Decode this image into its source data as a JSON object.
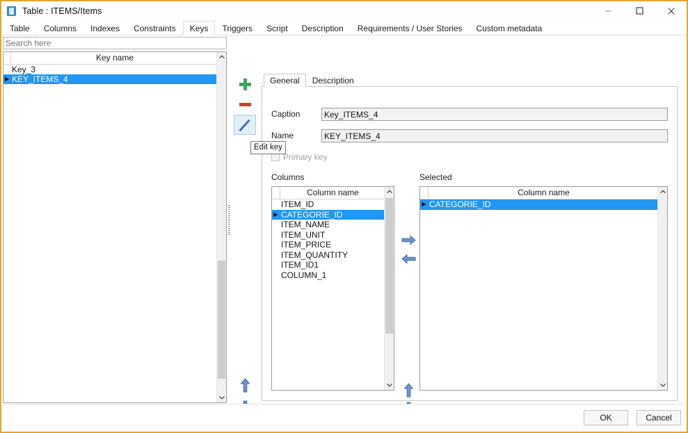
{
  "window": {
    "title": "Table : ITEMS/Items",
    "icon": "table-icon",
    "minimize_label": "–",
    "maximize_label": "□",
    "close_label": "✕",
    "border_color": "#e3a62a"
  },
  "tabs": [
    {
      "label": "Table",
      "active": false
    },
    {
      "label": "Columns",
      "active": false
    },
    {
      "label": "Indexes",
      "active": false
    },
    {
      "label": "Constraints",
      "active": false
    },
    {
      "label": "Keys",
      "active": true
    },
    {
      "label": "Triggers",
      "active": false
    },
    {
      "label": "Script",
      "active": false
    },
    {
      "label": "Description",
      "active": false
    },
    {
      "label": "Requirements / User Stories",
      "active": false
    },
    {
      "label": "Custom metadata",
      "active": false
    }
  ],
  "search": {
    "value": "",
    "placeholder": "Search here"
  },
  "keys_grid": {
    "header": "Key name",
    "rows": [
      {
        "name": "Key_3",
        "selected": false,
        "indicator": ""
      },
      {
        "name": "KEY_ITEMS_4",
        "selected": true,
        "indicator": "▶"
      }
    ]
  },
  "toolbar": {
    "add_label": "add-key",
    "remove_label": "remove-key",
    "edit_label": "edit-key",
    "tooltip": "Edit key",
    "add_color": "#3fa35f",
    "remove_color": "#c9422f",
    "edit_color": "#3f6fb4"
  },
  "inner_tabs": [
    {
      "label": "General",
      "active": true
    },
    {
      "label": "Description",
      "active": false
    }
  ],
  "general": {
    "caption_label": "Caption",
    "caption_value": "Key_ITEMS_4",
    "name_label": "Name",
    "name_value": "KEY_ITEMS_4",
    "primary_key_label": "Primary key",
    "primary_key_checked": false
  },
  "columns_panel": {
    "label": "Columns",
    "header": "Column name",
    "rows": [
      {
        "name": "ITEM_ID",
        "selected": false,
        "indicator": ""
      },
      {
        "name": "CATEGORIE_ID",
        "selected": true,
        "indicator": "▶"
      },
      {
        "name": "ITEM_NAME",
        "selected": false,
        "indicator": ""
      },
      {
        "name": "ITEM_UNIT",
        "selected": false,
        "indicator": ""
      },
      {
        "name": "ITEM_PRICE",
        "selected": false,
        "indicator": ""
      },
      {
        "name": "ITEM_QUANTITY",
        "selected": false,
        "indicator": ""
      },
      {
        "name": "ITEM_ID1",
        "selected": false,
        "indicator": ""
      },
      {
        "name": "COLUMN_1",
        "selected": false,
        "indicator": ""
      }
    ]
  },
  "selected_panel": {
    "label": "Selected",
    "header": "Column name",
    "rows": [
      {
        "name": "CATEGORIE_ID",
        "selected": true,
        "indicator": "▶"
      }
    ]
  },
  "transfer_buttons": {
    "move_right": "move-right",
    "move_left": "move-left",
    "move_up": "move-up",
    "move_down": "move-down",
    "arrow_color": "#3f6fb4"
  },
  "reorder_buttons": {
    "up": "move-key-up",
    "down": "move-key-down"
  },
  "footer": {
    "ok_label": "OK",
    "cancel_label": "Cancel"
  },
  "selection_color": "#2196f3"
}
